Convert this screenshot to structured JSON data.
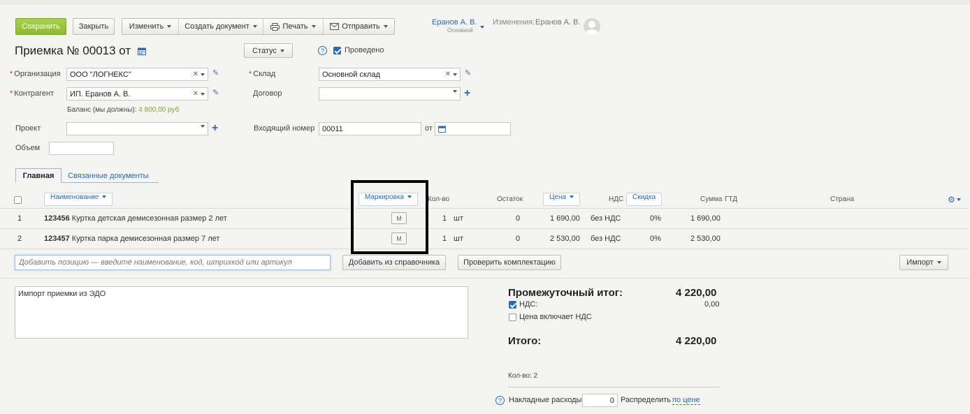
{
  "toolbar": {
    "save": "Сохранить",
    "close": "Закрыть",
    "edit": "Изменить",
    "create_doc": "Создать документ",
    "print": "Печать",
    "send": "Отправить"
  },
  "user": {
    "name": "Еранов А. В.",
    "role": "Основной",
    "changes_label": "Изменения:",
    "changes_user": "Еранов А. В."
  },
  "doc": {
    "title_prefix": "Приемка №",
    "number": "00013",
    "from": "от",
    "status": "Статус",
    "posted": "Проведено"
  },
  "form": {
    "org_label": "Организация",
    "org_value": "ООО \"ЛОГНЕКС\"",
    "contractor_label": "Контрагент",
    "contractor_value": "ИП. Еранов А. В.",
    "balance_label": "Баланс (мы должны):",
    "balance_value": "4 800,00 руб",
    "project_label": "Проект",
    "volume_label": "Объем",
    "warehouse_label": "Склад",
    "warehouse_value": "Основной склад",
    "contract_label": "Договор",
    "incoming_label": "Входящий номер",
    "incoming_value": "00011",
    "incoming_from": "от"
  },
  "tabs": [
    "Главная",
    "Связанные документы"
  ],
  "table": {
    "headers": {
      "name": "Наименование",
      "marking": "Маркировка",
      "qty": "Кол-во",
      "stock": "Остаток",
      "price": "Цена",
      "vat": "НДС",
      "discount": "Скидка",
      "sum": "Сумма",
      "gtd": "ГТД",
      "country": "Страна"
    },
    "rows": [
      {
        "n": "1",
        "code": "123456",
        "name": "Куртка детская демисезонная размер 2 лет",
        "mark": "М",
        "qty": "1",
        "unit": "шт",
        "stock": "0",
        "price": "1 690,00",
        "vat": "без НДС",
        "discount": "0%",
        "sum": "1 690,00"
      },
      {
        "n": "2",
        "code": "123457",
        "name": "Куртка парка демисезонная размер 7 лет",
        "mark": "М",
        "qty": "1",
        "unit": "шт",
        "stock": "0",
        "price": "2 530,00",
        "vat": "без НДС",
        "discount": "0%",
        "sum": "2 530,00"
      }
    ]
  },
  "add": {
    "placeholder": "Добавить позицию — введите наименование, код, штрихкод или артикул",
    "from_catalog": "Добавить из справочника",
    "check": "Проверить комплектацию",
    "import": "Импорт"
  },
  "comment": "Импорт приемки из ЭДО",
  "totals": {
    "subtotal_label": "Промежуточный итог:",
    "subtotal_value": "4 220,00",
    "vat_label": "НДС:",
    "vat_value": "0,00",
    "price_incl_vat": "Цена включает НДС",
    "total_label": "Итого:",
    "total_value": "4 220,00",
    "count": "Кол-во: 2",
    "overhead_label": "Накладные расходы",
    "overhead_value": "0",
    "distribute": "Распределить",
    "by_price": "по цене"
  }
}
